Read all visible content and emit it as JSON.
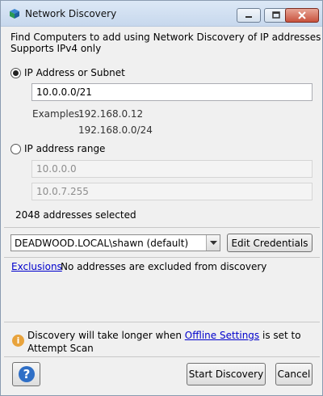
{
  "window": {
    "title": "Network Discovery",
    "accent": "#2b6fb6"
  },
  "intro": {
    "line1": "Find Computers to add using Network Discovery of IP addresses",
    "line2": "Supports IPv4 only"
  },
  "ip_subnet": {
    "label": "IP Address or Subnet",
    "selected": true,
    "value": "10.0.0.0/21",
    "examples_label": "Examples:",
    "example1": "192.168.0.12",
    "example2": "192.168.0.0/24"
  },
  "ip_range": {
    "label": "IP address range",
    "selected": false,
    "start": "10.0.0.0",
    "end": "10.0.7.255"
  },
  "selected_count": "2048 addresses selected",
  "credentials": {
    "selected": "DEADWOOD.LOCAL\\shawn (default)",
    "edit_label": "Edit Credentials"
  },
  "exclusions": {
    "link": "Exclusions",
    "text": "No addresses are excluded from discovery"
  },
  "info": {
    "before": "Discovery will take longer when ",
    "link": "Offline Settings",
    "after": " is set to Attempt Scan",
    "icon": "warning-info-icon",
    "color": "#e8a33c"
  },
  "buttons": {
    "start": "Start Discovery",
    "cancel": "Cancel",
    "help_icon": "question-icon"
  }
}
